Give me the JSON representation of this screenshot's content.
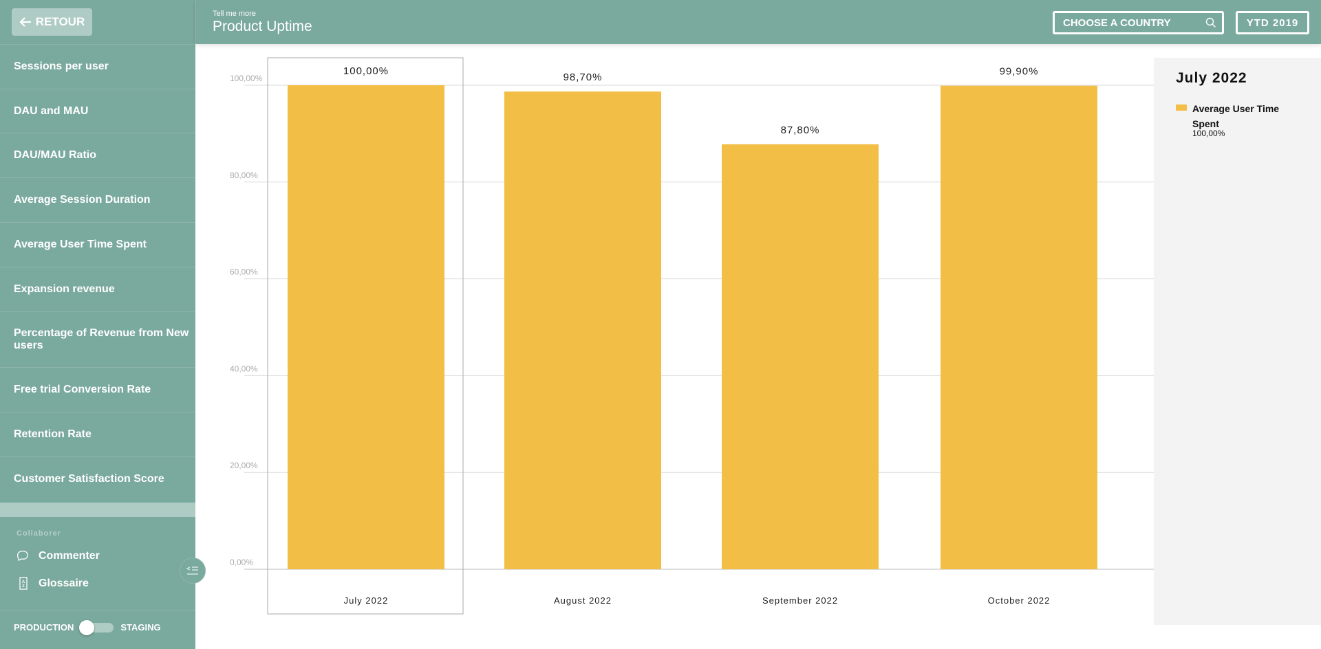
{
  "sidebar": {
    "back_label": "RETOUR",
    "items": [
      {
        "label": "Sessions per user"
      },
      {
        "label": "DAU and MAU"
      },
      {
        "label": "DAU/MAU Ratio"
      },
      {
        "label": "Average Session Duration"
      },
      {
        "label": "Average User Time Spent"
      },
      {
        "label": "Expansion revenue"
      },
      {
        "label": "Percentage of Revenue from New users"
      },
      {
        "label": "Free trial Conversion Rate"
      },
      {
        "label": "Retention Rate"
      },
      {
        "label": "Customer Satisfaction Score"
      }
    ],
    "collab_label": "Collaborer",
    "comment_label": "Commenter",
    "glossary_label": "Glossaire",
    "env_left": "PRODUCTION",
    "env_right": "STAGING"
  },
  "header": {
    "subtitle": "Tell me more",
    "title": "Product Uptime",
    "country_placeholder": "CHOOSE A COUNTRY",
    "period": "YTD 2019"
  },
  "legend": {
    "title": "July 2022",
    "series_name": "Average User Time Spent",
    "value": "100,00%"
  },
  "colors": {
    "brand": "#7aa99d",
    "bar": "#f2be45",
    "panel": "#f3f3f3"
  },
  "chart_data": {
    "type": "bar",
    "categories": [
      "July 2022",
      "August 2022",
      "September 2022",
      "October 2022"
    ],
    "values": [
      100.0,
      98.7,
      87.8,
      99.9
    ],
    "value_labels": [
      "100,00%",
      "98,70%",
      "87,80%",
      "99,90%"
    ],
    "yticks": [
      "0,00%",
      "20,00%",
      "40,00%",
      "60,00%",
      "80,00%",
      "100,00%"
    ],
    "ylim": [
      0,
      100
    ],
    "grid": true,
    "selected": "July 2022",
    "legend_placement": "right"
  }
}
